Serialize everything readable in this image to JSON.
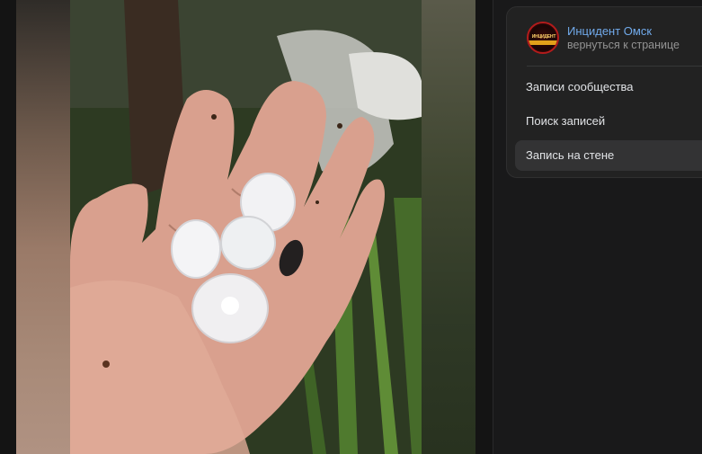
{
  "group": {
    "name": "Инцидент Омск",
    "back_link": "вернуться к странице",
    "avatar_text": "ИНЦИДЕНТ"
  },
  "menu": [
    {
      "label": "Записи сообщества",
      "active": false
    },
    {
      "label": "Поиск записей",
      "active": false
    },
    {
      "label": "Запись на стене",
      "active": true
    }
  ],
  "colors": {
    "link": "#71aaeb",
    "muted": "#939393",
    "text": "#e1e3e6",
    "active_bg": "#333334"
  }
}
